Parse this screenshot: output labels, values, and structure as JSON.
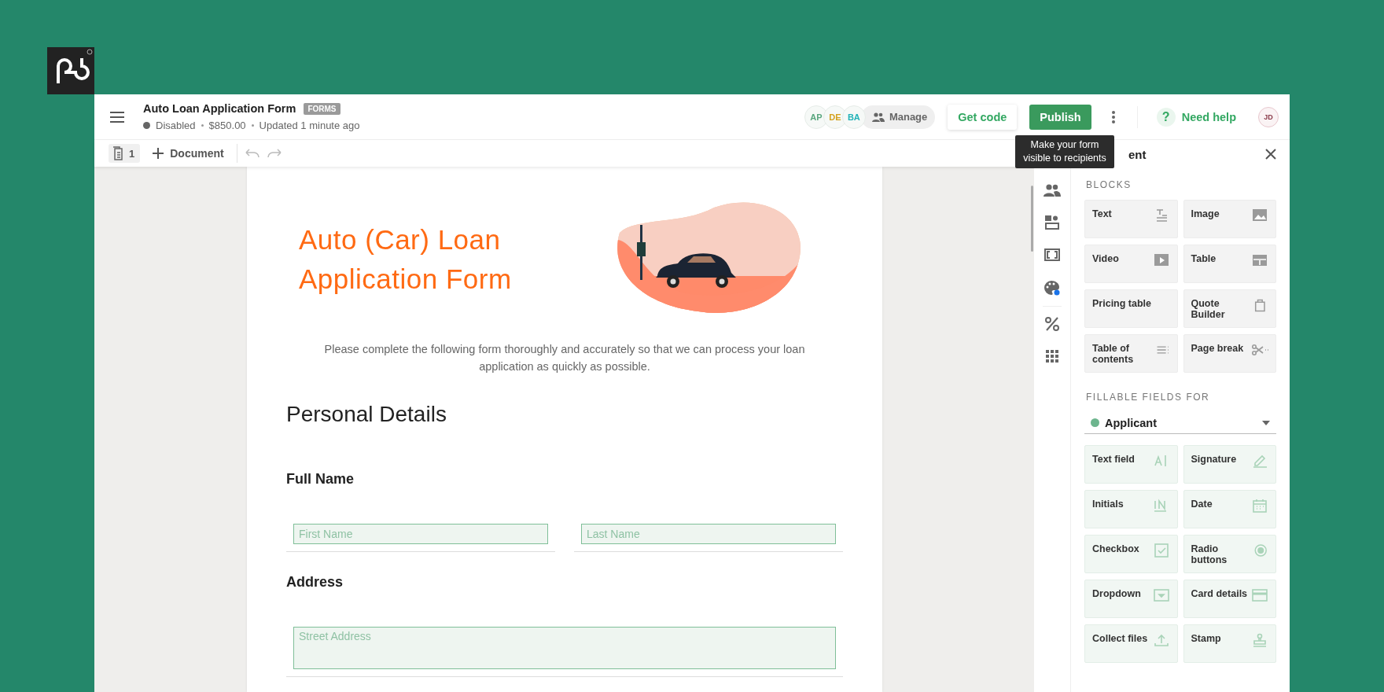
{
  "header": {
    "title": "Auto Loan Application Form",
    "badge": "FORMS",
    "meta": [
      "Disabled",
      "$850.00",
      "Updated 1 minute ago"
    ]
  },
  "collaborators": [
    {
      "initials": "AP",
      "color": "#5aa77f"
    },
    {
      "initials": "DE",
      "color": "#d4a21e"
    },
    {
      "initials": "BA",
      "color": "#22b3b8"
    }
  ],
  "manage_button": "Manage",
  "get_code_button": "Get code",
  "publish_button": "Publish",
  "tooltip": "Make your form visible to recipients",
  "help": {
    "icon": "?",
    "label": "Need help"
  },
  "user_initials": "JD",
  "toolbar": {
    "page_count": "1",
    "add_document": "Document"
  },
  "document": {
    "title": "Auto (Car) Loan Application Form",
    "description": "Please complete the following form thoroughly and accurately so that we can process your loan application as quickly as possible.",
    "section_title": "Personal Details",
    "groups": [
      {
        "label": "Full Name",
        "inputs": [
          {
            "placeholder": "First Name",
            "kind": "line"
          },
          {
            "placeholder": "Last Name",
            "kind": "line"
          }
        ]
      },
      {
        "label": "Address",
        "inputs": [
          {
            "placeholder": "Street Address",
            "kind": "area"
          }
        ]
      }
    ]
  },
  "panel": {
    "title": "ent",
    "blocks_heading": "BLOCKS",
    "blocks": [
      "Text",
      "Image",
      "Video",
      "Table",
      "Pricing table",
      "Quote Builder",
      "Table of contents",
      "Page break"
    ],
    "fields_heading": "FILLABLE FIELDS FOR",
    "recipient": {
      "name": "Applicant",
      "color": "#6db58e"
    },
    "fields": [
      "Text field",
      "Signature",
      "Initials",
      "Date",
      "Checkbox",
      "Radio buttons",
      "Dropdown",
      "Card details",
      "Collect files",
      "Stamp"
    ]
  }
}
